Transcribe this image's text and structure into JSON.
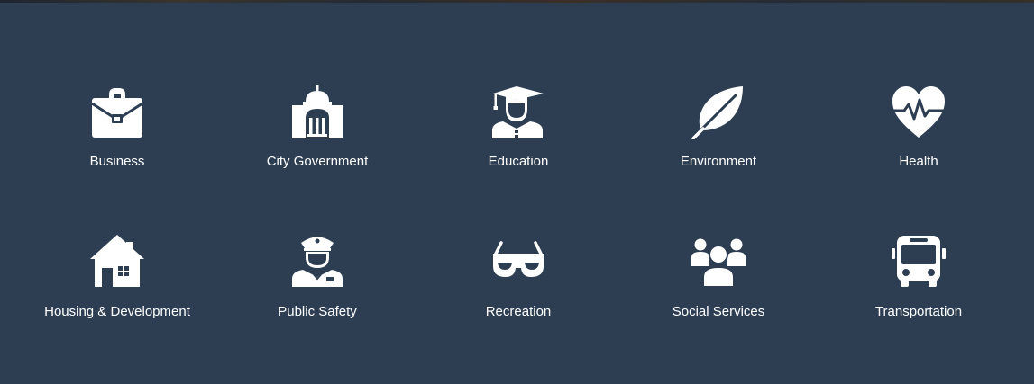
{
  "categories": [
    {
      "label": "Business",
      "icon": "briefcase-icon"
    },
    {
      "label": "City Government",
      "icon": "capitol-building-icon"
    },
    {
      "label": "Education",
      "icon": "graduate-icon"
    },
    {
      "label": "Environment",
      "icon": "leaf-icon"
    },
    {
      "label": "Health",
      "icon": "heart-pulse-icon"
    },
    {
      "label": "Housing & Development",
      "icon": "house-icon"
    },
    {
      "label": "Public Safety",
      "icon": "police-officer-icon"
    },
    {
      "label": "Recreation",
      "icon": "sunglasses-icon"
    },
    {
      "label": "Social Services",
      "icon": "people-group-icon"
    },
    {
      "label": "Transportation",
      "icon": "bus-icon"
    }
  ],
  "colors": {
    "background": "#2e3e52",
    "foreground": "#ffffff"
  }
}
